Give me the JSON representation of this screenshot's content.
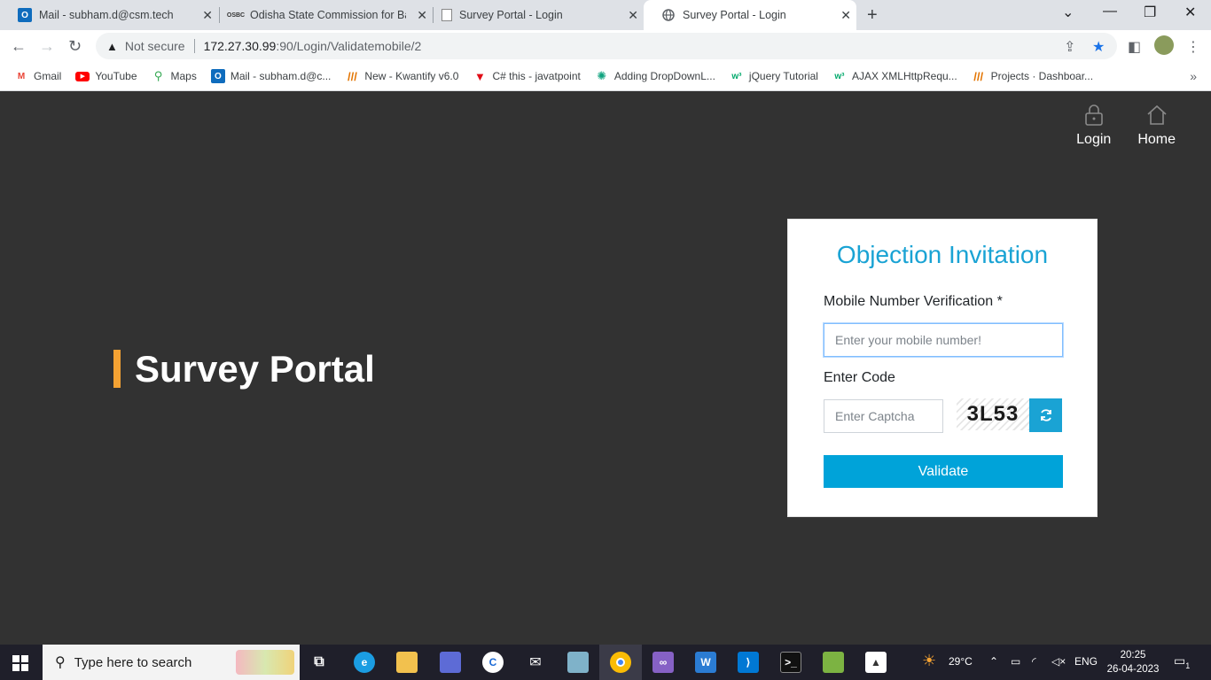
{
  "browser": {
    "tabs": [
      {
        "title": "Mail - subham.d@csm.tech",
        "active": false
      },
      {
        "title": "Odisha State Commission for Bac",
        "active": false
      },
      {
        "title": "Survey Portal - Login",
        "active": false
      },
      {
        "title": "Survey Portal - Login",
        "active": true
      }
    ],
    "address": {
      "security_label": "Not secure",
      "url_host": "172.27.30.99",
      "url_rest": ":90/Login/Validatemobile/2"
    },
    "bookmarks": [
      {
        "label": "Gmail",
        "icon": "gmail-icon",
        "color": "#ea4335"
      },
      {
        "label": "YouTube",
        "icon": "youtube-icon",
        "color": "#ff0000"
      },
      {
        "label": "Maps",
        "icon": "maps-icon",
        "color": "#34a853"
      },
      {
        "label": "Mail - subham.d@c...",
        "icon": "outlook-icon",
        "color": "#0f6cbd"
      },
      {
        "label": "New - Kwantify v6.0",
        "icon": "kwantify-icon",
        "color": "#e37400"
      },
      {
        "label": "C# this - javatpoint",
        "icon": "javatpoint-icon",
        "color": "#e10b16"
      },
      {
        "label": "Adding DropDownL...",
        "icon": "openai-icon",
        "color": "#10a37f"
      },
      {
        "label": "jQuery Tutorial",
        "icon": "w3schools-icon",
        "color": "#04aa6d"
      },
      {
        "label": "AJAX XMLHttpRequ...",
        "icon": "w3schools-icon",
        "color": "#04aa6d"
      },
      {
        "label": "Projects · Dashboar...",
        "icon": "azure-devops-icon",
        "color": "#e37400"
      }
    ]
  },
  "page": {
    "nav": {
      "login": "Login",
      "home": "Home"
    },
    "brand": "Survey Portal",
    "form": {
      "title": "Objection Invitation",
      "mobile_label": "Mobile Number Verification *",
      "mobile_placeholder": "Enter your mobile number!",
      "code_label": "Enter Code",
      "captcha_placeholder": "Enter Captcha",
      "captcha_text": "3L53",
      "validate_label": "Validate"
    },
    "colors": {
      "accent": "#1aa3d4",
      "brand_bar": "#f4a233",
      "background": "#323232"
    }
  },
  "taskbar": {
    "search_placeholder": "Type here to search",
    "weather": "29°C",
    "language": "ENG",
    "time": "20:25",
    "date": "26-04-2023",
    "notifications": "1"
  }
}
